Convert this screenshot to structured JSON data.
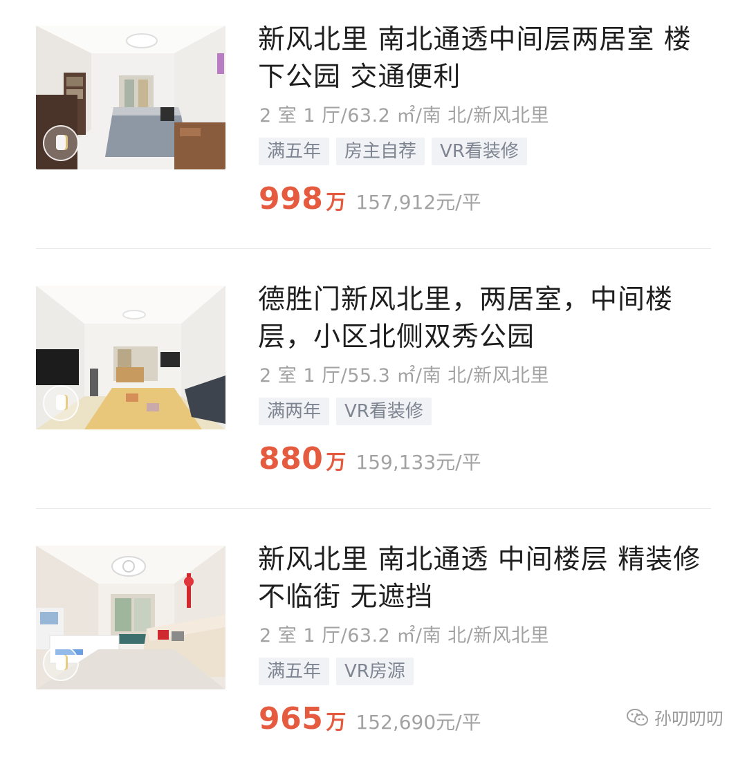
{
  "listings": [
    {
      "title": "新风北里 南北通透中间层两居室 楼下公园 交通便利",
      "meta": "2 室 1 厅/63.2 ㎡/南 北/新风北里",
      "tags": [
        "满五年",
        "房主自荐",
        "VR看装修"
      ],
      "price": "998",
      "price_unit": "万",
      "unit_price": "157,912元/平",
      "thumbnail": "bedroom-photo"
    },
    {
      "title": "德胜门新风北里，两居室，中间楼层，小区北侧双秀公园",
      "meta": "2 室 1 厅/55.3 ㎡/南 北/新风北里",
      "tags": [
        "满两年",
        "VR看装修"
      ],
      "price": "880",
      "price_unit": "万",
      "unit_price": "159,133元/平",
      "thumbnail": "living-room-photo"
    },
    {
      "title": "新风北里 南北通透 中间楼层 精装修 不临街 无遮挡",
      "meta": "2 室 1 厅/63.2 ㎡/南 北/新风北里",
      "tags": [
        "满五年",
        "VR房源"
      ],
      "price": "965",
      "price_unit": "万",
      "unit_price": "152,690元/平",
      "thumbnail": "living-room-sofa-photo"
    }
  ],
  "watermark": {
    "text": "孙叨叨叨",
    "icon": "wechat-icon"
  },
  "colors": {
    "price": "#e45b3f",
    "tag_bg": "#f0f2f6",
    "tag_text": "#7e8591",
    "meta": "#a2a2a2"
  }
}
